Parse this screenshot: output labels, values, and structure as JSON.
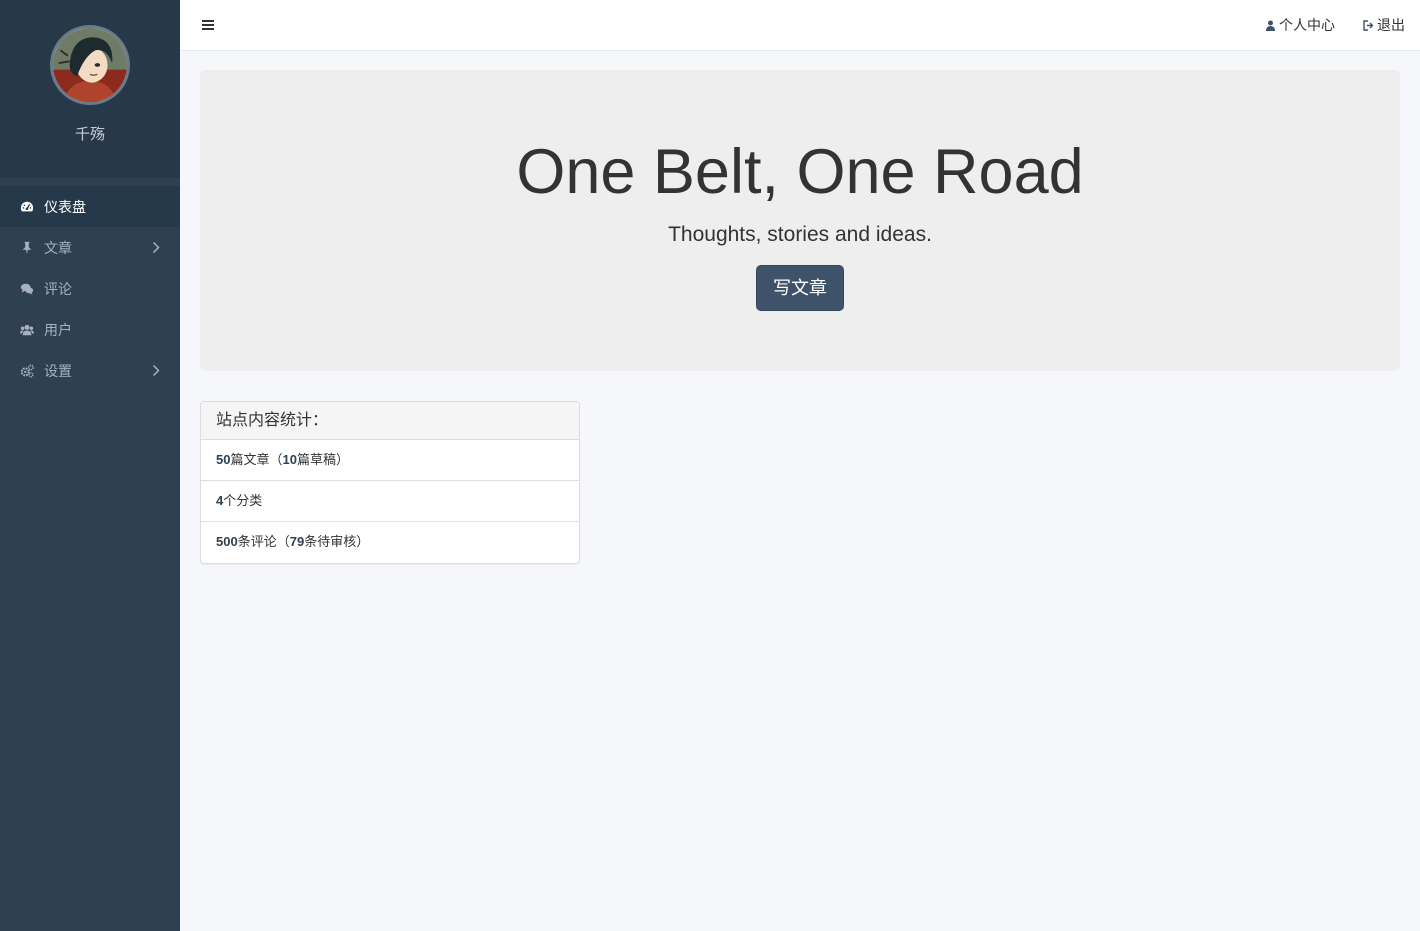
{
  "sidebar": {
    "profile_name": "千殇",
    "items": [
      {
        "label": "仪表盘",
        "icon": "dashboard-icon",
        "active": true
      },
      {
        "label": "文章",
        "icon": "pin-icon",
        "has_children": true
      },
      {
        "label": "评论",
        "icon": "comments-icon"
      },
      {
        "label": "用户",
        "icon": "users-icon"
      },
      {
        "label": "设置",
        "icon": "cogs-icon",
        "has_children": true
      }
    ]
  },
  "header": {
    "profile_link": "个人中心",
    "logout_link": "退出"
  },
  "jumbotron": {
    "title": "One Belt, One Road",
    "subtitle": "Thoughts, stories and ideas.",
    "button": "写文章"
  },
  "stats": {
    "heading": "站点内容统计：",
    "posts": {
      "count": "50",
      "unit": "篇文章（",
      "drafts": "10",
      "drafts_unit": "篇草稿）"
    },
    "categories": {
      "count": "4",
      "unit": "个分类"
    },
    "comments": {
      "count": "500",
      "unit": "条评论（",
      "pending": "79",
      "pending_unit": "条待审核）"
    }
  },
  "colors": {
    "sidebar_bg": "#2f4050",
    "accent": "#3e5369",
    "jumbotron_bg": "#eeeeee"
  }
}
